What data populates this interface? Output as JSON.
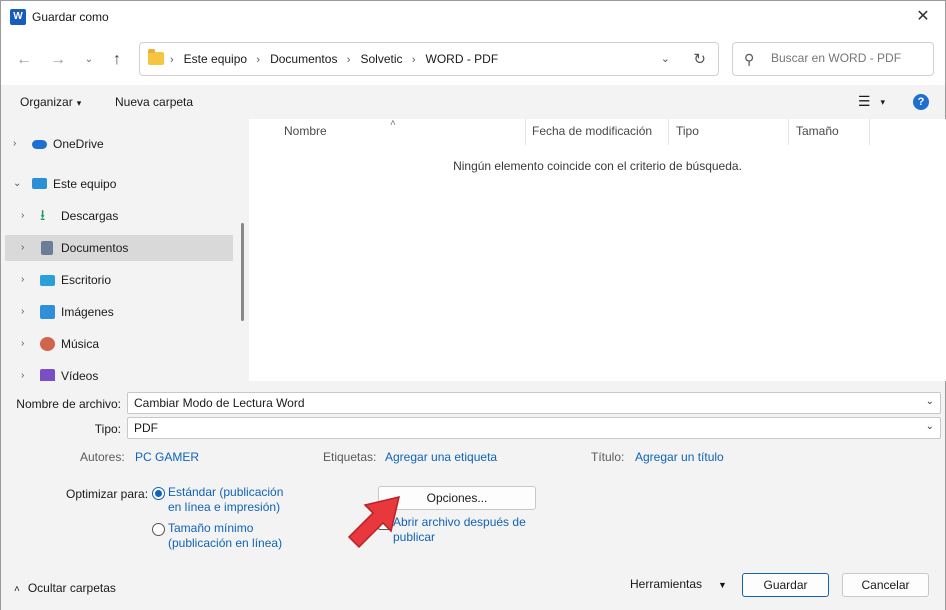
{
  "window": {
    "title": "Guardar como",
    "app_icon_letter": "W",
    "close_glyph": "✕"
  },
  "nav": {
    "back_glyph": "←",
    "forward_glyph": "→",
    "recent_glyph": "⌄",
    "up_glyph": "↑",
    "breadcrumb": [
      "Este equipo",
      "Documentos",
      "Solvetic",
      "WORD - PDF"
    ],
    "breadcrumb_sep": "›",
    "dropdown_glyph": "⌄",
    "refresh_glyph": "↻",
    "search_placeholder": "Buscar en WORD - PDF",
    "search_glyph": "⚲"
  },
  "toolbar": {
    "organize_label": "Organizar",
    "new_folder_label": "Nueva carpeta",
    "view_glyph": "☰",
    "caret": "▾",
    "help_glyph": "?"
  },
  "sidebar": {
    "items": [
      {
        "label": "OneDrive",
        "chev": "›",
        "icon": "cloud-icon",
        "color": "#1f6fd0"
      },
      {
        "label": "Este equipo",
        "chev": "⌄",
        "icon": "computer-icon",
        "color": "#2b8fd6"
      },
      {
        "label": "Descargas",
        "chev": "›",
        "icon": "download-icon",
        "color": "#1a9c5a"
      },
      {
        "label": "Documentos",
        "chev": "›",
        "icon": "document-icon",
        "color": "#6b7d99"
      },
      {
        "label": "Escritorio",
        "chev": "›",
        "icon": "desktop-icon",
        "color": "#2a9fd8"
      },
      {
        "label": "Imágenes",
        "chev": "›",
        "icon": "pictures-icon",
        "color": "#2f8fd8"
      },
      {
        "label": "Música",
        "chev": "›",
        "icon": "music-icon",
        "color": "#d0654e"
      },
      {
        "label": "Vídeos",
        "chev": "›",
        "icon": "videos-icon",
        "color": "#7a4fc4"
      }
    ],
    "selected": "Documentos"
  },
  "filepane": {
    "columns": [
      "Nombre",
      "Fecha de modificación",
      "Tipo",
      "Tamaño"
    ],
    "sort_glyph": "˄",
    "empty_message": "Ningún elemento coincide con el criterio de búsqueda."
  },
  "form": {
    "filename_label": "Nombre de archivo:",
    "filename_value": "Cambiar Modo de Lectura Word",
    "type_label": "Tipo:",
    "type_value": "PDF",
    "dropdown_glyph": "⌄",
    "authors_label": "Autores:",
    "authors_value": "PC GAMER",
    "tags_label": "Etiquetas:",
    "tags_value": "Agregar una etiqueta",
    "title_label": "Título:",
    "title_value": "Agregar un título",
    "optimize_label": "Optimizar para:",
    "radio_standard": "Estándar (publicación en línea e impresión)",
    "radio_minimum": "Tamaño mínimo (publicación en línea)",
    "options_button": "Opciones...",
    "open_after_label": "Abrir archivo después de publicar"
  },
  "footer": {
    "hide_folders_label": "Ocultar carpetas",
    "hide_caret": "˄",
    "tools_label": "Herramientas",
    "tools_caret": "▼",
    "save_button": "Guardar",
    "cancel_button": "Cancelar"
  },
  "colors": {
    "accent": "#0f63b8",
    "arrow_annotation": "#e8383d"
  }
}
